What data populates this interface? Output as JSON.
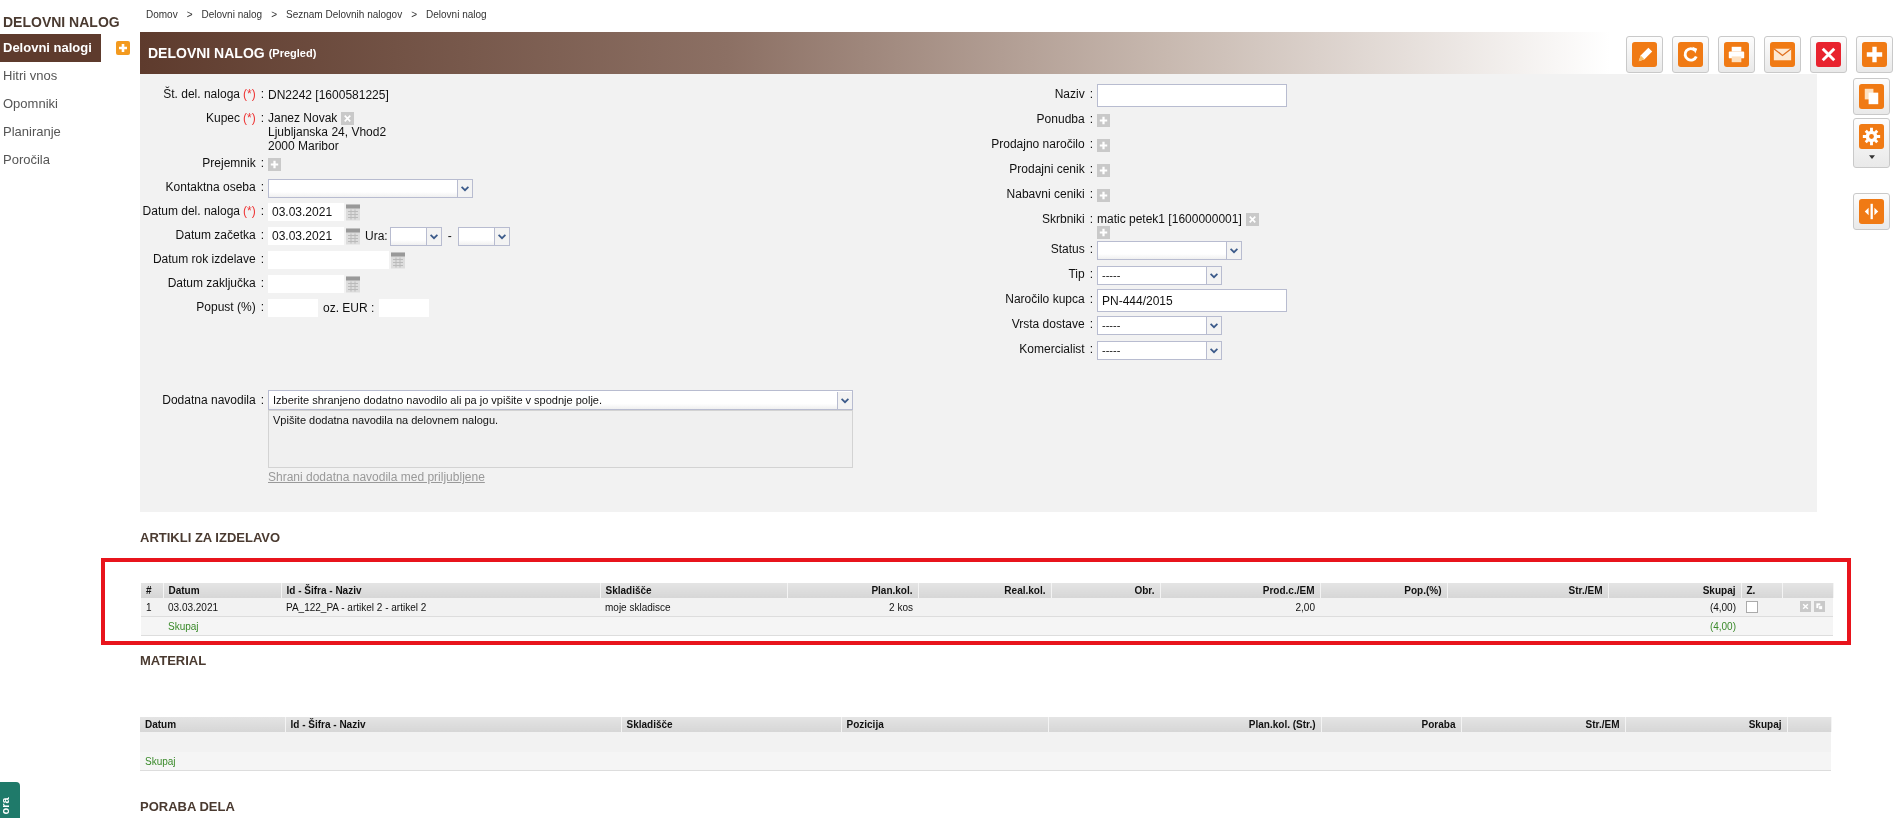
{
  "sidebar": {
    "title": "DELOVNI NALOG",
    "items": [
      {
        "label": "Delovni nalogi",
        "selected": true
      },
      {
        "label": "Hitri vnos",
        "selected": false
      },
      {
        "label": "Opomniki",
        "selected": false
      },
      {
        "label": "Planiranje",
        "selected": false
      },
      {
        "label": "Poročila",
        "selected": false
      }
    ],
    "feedback_tab": {
      "label": "ora"
    }
  },
  "breadcrumb": [
    {
      "label": "Domov",
      "separator": ">"
    },
    {
      "label": "Delovni nalog",
      "separator": ">"
    },
    {
      "label": "Seznam Delovnih nalogov",
      "separator": ">"
    },
    {
      "label": "Delovni nalog"
    }
  ],
  "header": {
    "title": "DELOVNI NALOG",
    "subtitle": "(Pregled)"
  },
  "left_fields": [
    {
      "kind": "text",
      "label": "Št. del. naloga",
      "required_mark": "(*)",
      "colon": ":",
      "value": "DN2242 [1600581225]"
    },
    {
      "kind": "customer",
      "label": "Kupec",
      "required_mark": "(*)",
      "colon": ":",
      "lines": [
        "Janez Novak",
        "Ljubljanska 24, Vhod2",
        "2000 Maribor"
      ]
    },
    {
      "kind": "add",
      "label": "Prejemnik",
      "colon": ":"
    },
    {
      "kind": "select",
      "label": "Kontaktna oseba",
      "colon": ":"
    },
    {
      "kind": "date",
      "label": "Datum del. naloga",
      "required_mark": "(*)",
      "colon": ":",
      "value": "03.03.2021"
    },
    {
      "kind": "date_time",
      "label": "Datum začetka",
      "colon": ":",
      "value": "03.03.2021",
      "time_label": "Ura:",
      "time_separator": "-"
    },
    {
      "kind": "date",
      "label": "Datum rok izdelave",
      "colon": ":"
    },
    {
      "kind": "date",
      "label": "Datum zaključka",
      "colon": ":"
    },
    {
      "kind": "discount",
      "label": "Popust (%)",
      "colon": ":",
      "second_label": "oz. EUR :"
    }
  ],
  "right_fields": [
    {
      "kind": "input",
      "label": "Naziv",
      "colon": ":"
    },
    {
      "kind": "add",
      "label": "Ponudba",
      "colon": ":"
    },
    {
      "kind": "add",
      "label": "Prodajno naročilo",
      "colon": ":"
    },
    {
      "kind": "add",
      "label": "Prodajni cenik",
      "colon": ":"
    },
    {
      "kind": "add",
      "label": "Nabavni ceniki",
      "colon": ":"
    },
    {
      "kind": "person",
      "label": "Skrbniki",
      "colon": ":",
      "value": "matic petek1 [1600000001]"
    },
    {
      "kind": "select",
      "label": "Status",
      "colon": ":"
    },
    {
      "kind": "select_short",
      "label": "Tip",
      "colon": ":",
      "value": "-----"
    },
    {
      "kind": "input",
      "label": "Naročilo kupca",
      "colon": ":",
      "value": "PN-444/2015"
    },
    {
      "kind": "select_short",
      "label": "Vrsta dostave",
      "colon": ":",
      "value": "-----"
    },
    {
      "kind": "select_short",
      "label": "Komercialist",
      "colon": ":",
      "value": "-----"
    }
  ],
  "instructions": {
    "label": "Dodatna navodila",
    "colon": ":",
    "select_value": "Izberite shranjeno dodatno navodilo ali pa jo vpišite v spodnje polje.",
    "text": "Vpišite dodatna navodila na delovnem nalogu.",
    "save_link": "Shrani dodatna navodila med priljubljene"
  },
  "articles": {
    "title": "ARTIKLI ZA IZDELAVO",
    "columns": [
      "#",
      "Datum",
      "Id - Šifra - Naziv",
      "Skladišče",
      "Plan.kol.",
      "Real.kol.",
      "Obr.",
      "Prod.c./EM",
      "Pop.(%)",
      "Str./EM",
      "Skupaj",
      "Z."
    ],
    "rows": [
      {
        "cells": [
          "1",
          "03.03.2021",
          "PA_122_PA - artikel 2 - artikel 2",
          "moje skladisce",
          "2 kos",
          "",
          "",
          "2,00",
          "",
          "",
          "(4,00)"
        ],
        "checked": false
      }
    ],
    "footer": {
      "label": "Skupaj",
      "total": "(4,00)"
    }
  },
  "material": {
    "title": "MATERIAL",
    "columns": [
      "Datum",
      "Id - Šifra - Naziv",
      "Skladišče",
      "Pozicija",
      "Plan.kol. (Str.)",
      "Poraba",
      "Str./EM",
      "Skupaj"
    ],
    "footer": {
      "label": "Skupaj"
    }
  },
  "labor": {
    "title": "PORABA DELA"
  }
}
